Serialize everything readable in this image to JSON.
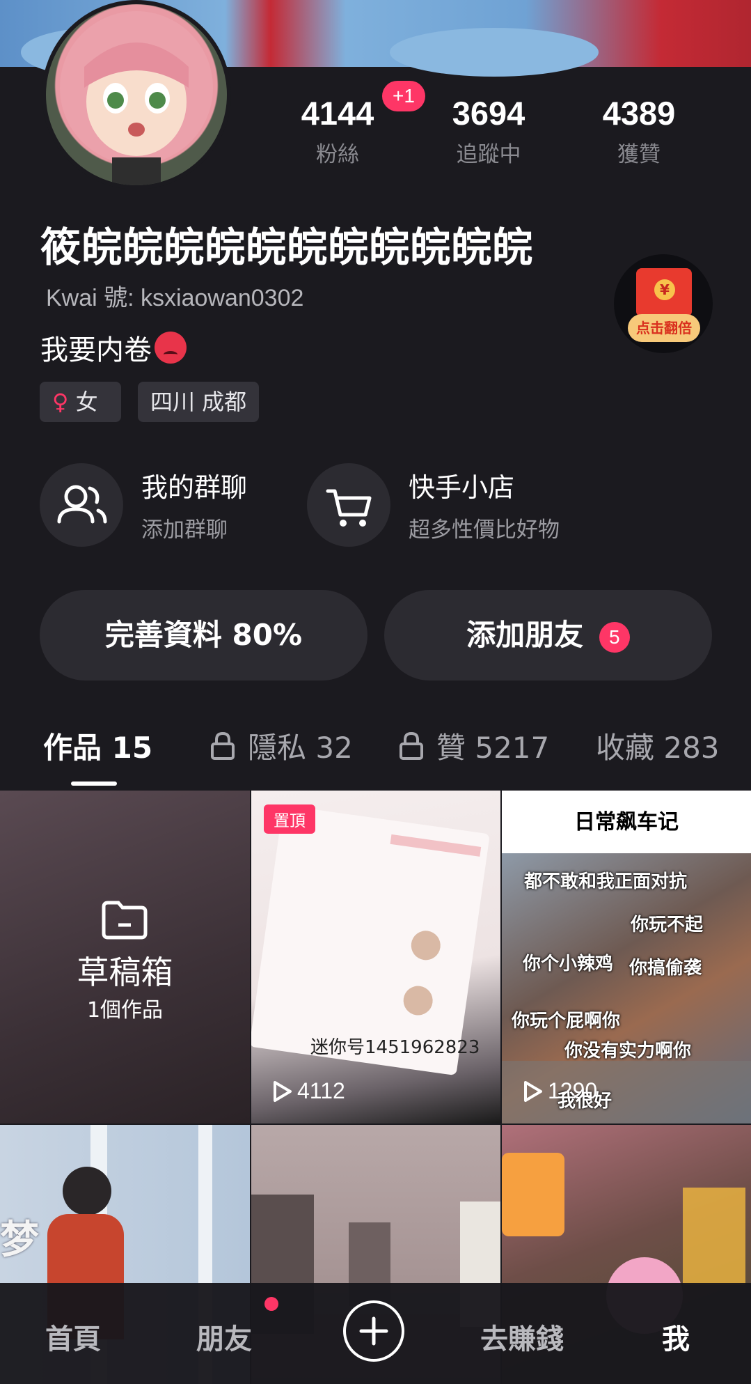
{
  "profile": {
    "stats": [
      {
        "value": "4144",
        "label": "粉絲"
      },
      {
        "value": "3694",
        "label": "追蹤中"
      },
      {
        "value": "4389",
        "label": "獲贊"
      }
    ],
    "new_followers_badge": "+1",
    "username": "筱皖皖皖皖皖皖皖皖皖皖皖",
    "kwai_id": "Kwai 號: ksxiaowan0302",
    "bio": "我要内卷",
    "gender_tag": "女",
    "location_tag": "四川 成都",
    "red_packet_label": "点击翻倍",
    "red_packet_coin": "¥"
  },
  "features": {
    "group_chat": {
      "title": "我的群聊",
      "subtitle": "添加群聊"
    },
    "shop": {
      "title": "快手小店",
      "subtitle": "超多性價比好物"
    }
  },
  "actions": {
    "complete_profile": "完善資料 80%",
    "add_friends": "添加朋友",
    "add_friends_count": "5"
  },
  "tabs": [
    {
      "label": "作品 15"
    },
    {
      "label": "隱私 32"
    },
    {
      "label": "贊 5217"
    },
    {
      "label": "收藏 283"
    }
  ],
  "grid": {
    "drafts": {
      "title": "草稿箱",
      "count": "1個作品"
    },
    "pinned_label": "置頂",
    "video1": {
      "plays": "4112",
      "caption": "迷你号1451962823"
    },
    "video2": {
      "plays": "1290",
      "title": "日常飙车记",
      "lines": [
        "都不敢和我正面对抗",
        "你玩不起",
        "你个小辣鸡",
        "你搞偷袭",
        "你玩个屁啊你",
        "你没有实力啊你",
        "我很好"
      ]
    },
    "video3": {
      "overlay": "梦"
    }
  },
  "bottom_nav": {
    "home": "首頁",
    "friends": "朋友",
    "earn": "去賺錢",
    "me": "我"
  },
  "colors": {
    "accent": "#fe3666",
    "background": "#1b1a1f",
    "card": "#2c2b31"
  }
}
